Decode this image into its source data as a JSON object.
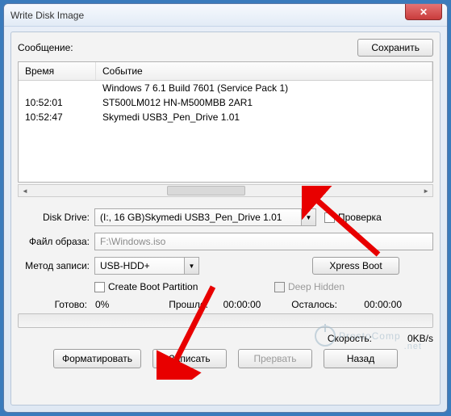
{
  "window": {
    "title": "Write Disk Image"
  },
  "message": {
    "label": "Сообщение:",
    "save_btn": "Сохранить",
    "col_time": "Время",
    "col_event": "Событие",
    "rows": [
      {
        "time": "",
        "event": "Windows 7 6.1 Build 7601 (Service Pack 1)"
      },
      {
        "time": "10:52:01",
        "event": "ST500LM012 HN-M500MBB   2AR1"
      },
      {
        "time": "10:52:47",
        "event": "Skymedi USB3_Pen_Drive  1.01"
      }
    ]
  },
  "form": {
    "disk_drive_label": "Disk Drive:",
    "disk_drive_value": "(I:, 16 GB)Skymedi USB3_Pen_Drive  1.01",
    "check_label": "Проверка",
    "image_label": "Файл образа:",
    "image_value": "F:\\Windows.iso",
    "method_label": "Метод записи:",
    "method_value": "USB-HDD+",
    "xpress_btn": "Xpress Boot",
    "create_boot_label": "Create Boot Partition",
    "deep_hidden_label": "Deep Hidden"
  },
  "status": {
    "ready_label": "Готово:",
    "percent": "0%",
    "elapsed_label": "Прошло:",
    "elapsed_value": "00:00:00",
    "remain_label": "Осталось:",
    "remain_value": "00:00:00",
    "speed_label": "Скорость:",
    "speed_value": "0KB/s"
  },
  "buttons": {
    "format": "Форматировать",
    "write": "Записать",
    "abort": "Прервать",
    "back": "Назад"
  },
  "watermark": {
    "text": "ProstoComp",
    "suffix": ".net"
  }
}
